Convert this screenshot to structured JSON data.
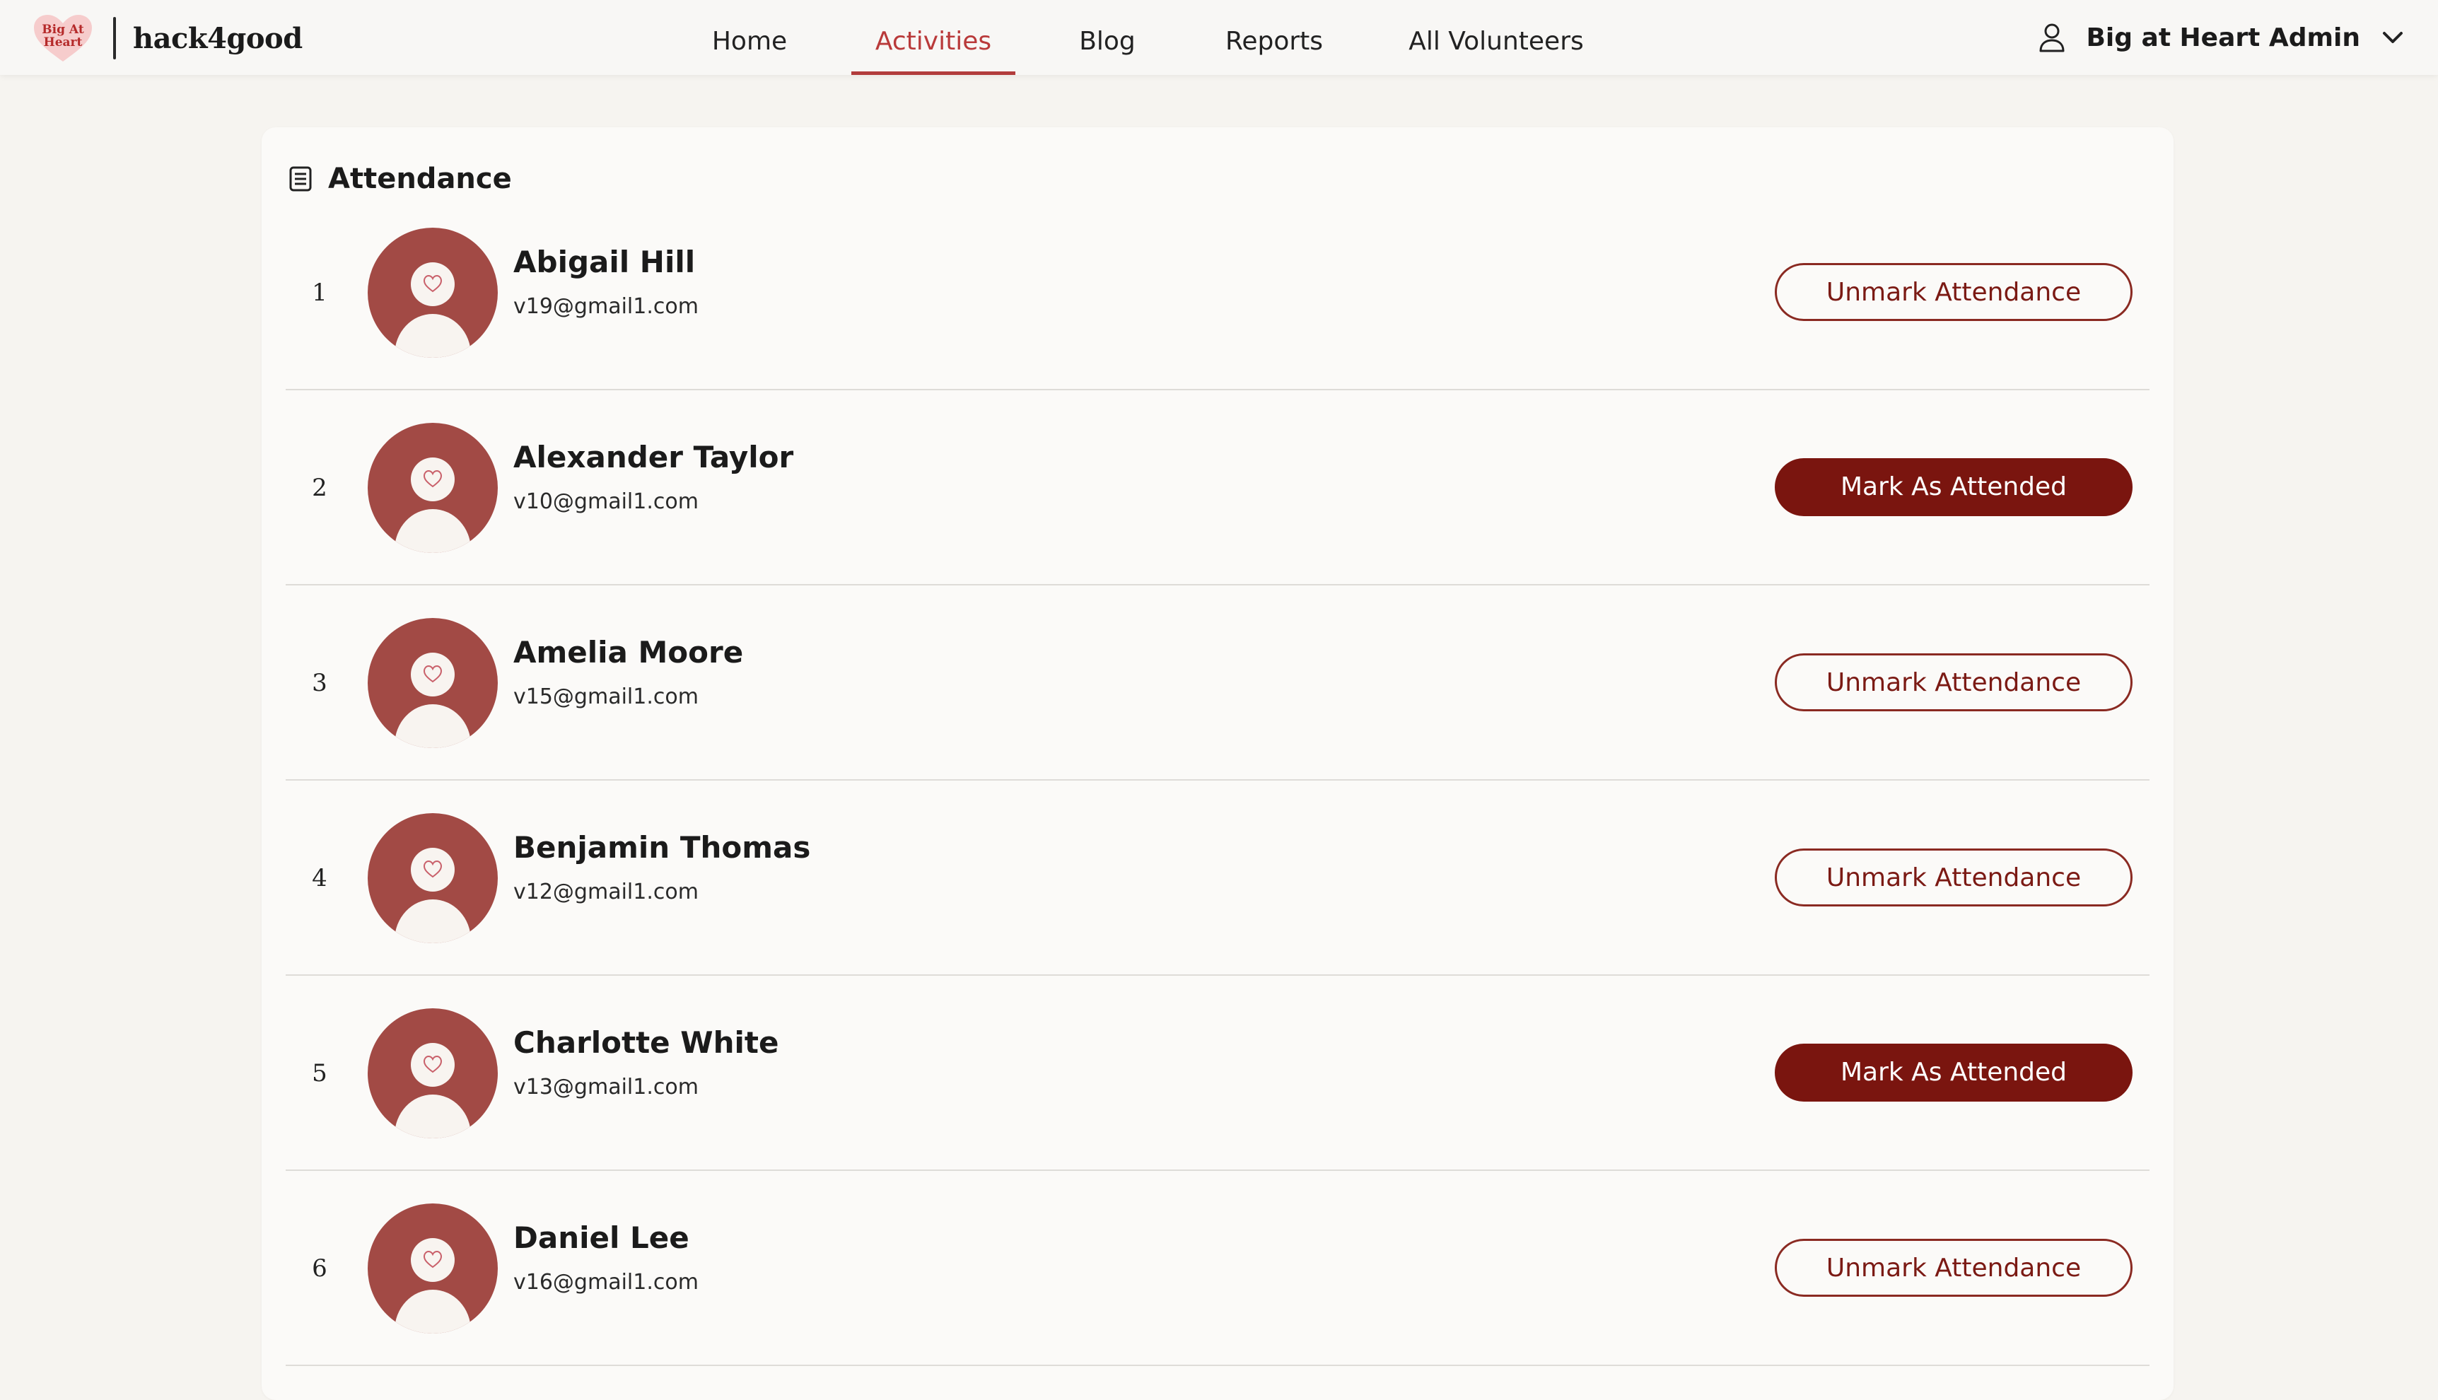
{
  "brand": {
    "logo_text_top": "Big At",
    "logo_text_bottom": "Heart",
    "name": "hack4good"
  },
  "nav": {
    "links": [
      {
        "label": "Home",
        "active": false
      },
      {
        "label": "Activities",
        "active": true
      },
      {
        "label": "Blog",
        "active": false
      },
      {
        "label": "Reports",
        "active": false
      },
      {
        "label": "All Volunteers",
        "active": false
      }
    ],
    "user": {
      "name": "Big at Heart Admin",
      "icon": "user-icon"
    }
  },
  "colors": {
    "accent": "#b93a3a",
    "button_dark": "#7a150f",
    "avatar": "#a24a45"
  },
  "attendance": {
    "title": "Attendance",
    "icon": "clipboard-list-icon",
    "volunteers": [
      {
        "index": "1",
        "name": "Abigail Hill",
        "email": "v19@gmail1.com",
        "action": "Unmark Attendance",
        "attended": true
      },
      {
        "index": "2",
        "name": "Alexander Taylor",
        "email": "v10@gmail1.com",
        "action": "Mark As Attended",
        "attended": false
      },
      {
        "index": "3",
        "name": "Amelia Moore",
        "email": "v15@gmail1.com",
        "action": "Unmark Attendance",
        "attended": true
      },
      {
        "index": "4",
        "name": "Benjamin Thomas",
        "email": "v12@gmail1.com",
        "action": "Unmark Attendance",
        "attended": true
      },
      {
        "index": "5",
        "name": "Charlotte White",
        "email": "v13@gmail1.com",
        "action": "Mark As Attended",
        "attended": false
      },
      {
        "index": "6",
        "name": "Daniel Lee",
        "email": "v16@gmail1.com",
        "action": "Unmark Attendance",
        "attended": true
      }
    ]
  }
}
